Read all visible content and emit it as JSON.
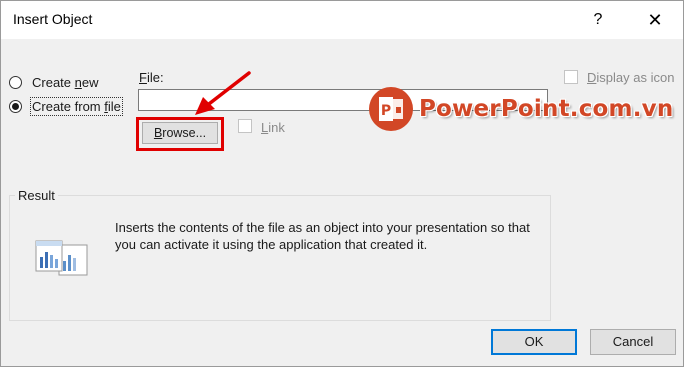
{
  "window": {
    "title": "Insert Object",
    "help_glyph": "?",
    "close_glyph": "✕"
  },
  "options": {
    "create_new": "Create new",
    "create_from_file": "Create from file",
    "selected": "create_from_file"
  },
  "file": {
    "label": "File:",
    "value": "",
    "browse_label": "Browse...",
    "link_label": "Link",
    "link_checked": false,
    "display_as_icon_label": "Display as icon",
    "display_as_icon_checked": false
  },
  "watermark": {
    "text": "PowerPoint.com.vn",
    "badge_letter": "P",
    "color": "#d24726"
  },
  "annotation": {
    "highlight_color": "#e00000"
  },
  "result": {
    "title": "Result",
    "description": "Inserts the contents of the file as an object into your presentation so that you can activate it using the application that created it."
  },
  "buttons": {
    "ok": "OK",
    "cancel": "Cancel"
  }
}
